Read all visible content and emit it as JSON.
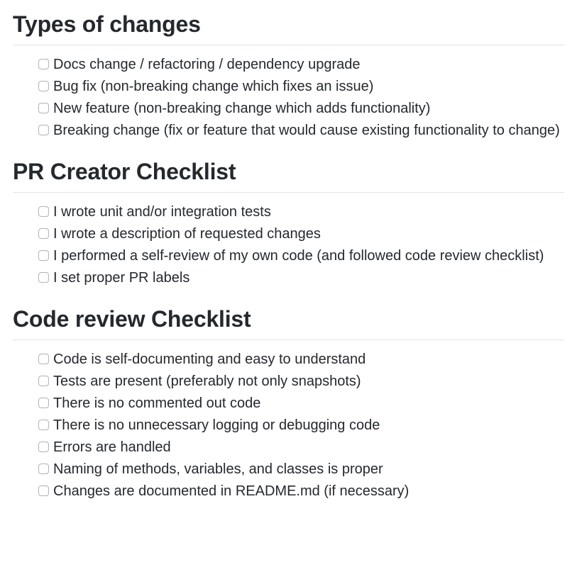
{
  "sections": [
    {
      "title": "Types of changes",
      "items": [
        "Docs change / refactoring / dependency upgrade",
        "Bug fix (non-breaking change which fixes an issue)",
        "New feature (non-breaking change which adds functionality)",
        "Breaking change (fix or feature that would cause existing functionality to change)"
      ]
    },
    {
      "title": "PR Creator Checklist",
      "items": [
        "I wrote unit and/or integration tests",
        "I wrote a description of requested changes",
        "I performed a self-review of my own code (and followed code review checklist)",
        "I set proper PR labels"
      ]
    },
    {
      "title": "Code review Checklist",
      "items": [
        "Code is self-documenting and easy to understand",
        "Tests are present (preferably not only snapshots)",
        "There is no commented out code",
        "There is no unnecessary logging or debugging code",
        "Errors are handled",
        "Naming of methods, variables, and classes is proper",
        "Changes are documented in README.md (if necessary)"
      ]
    }
  ]
}
